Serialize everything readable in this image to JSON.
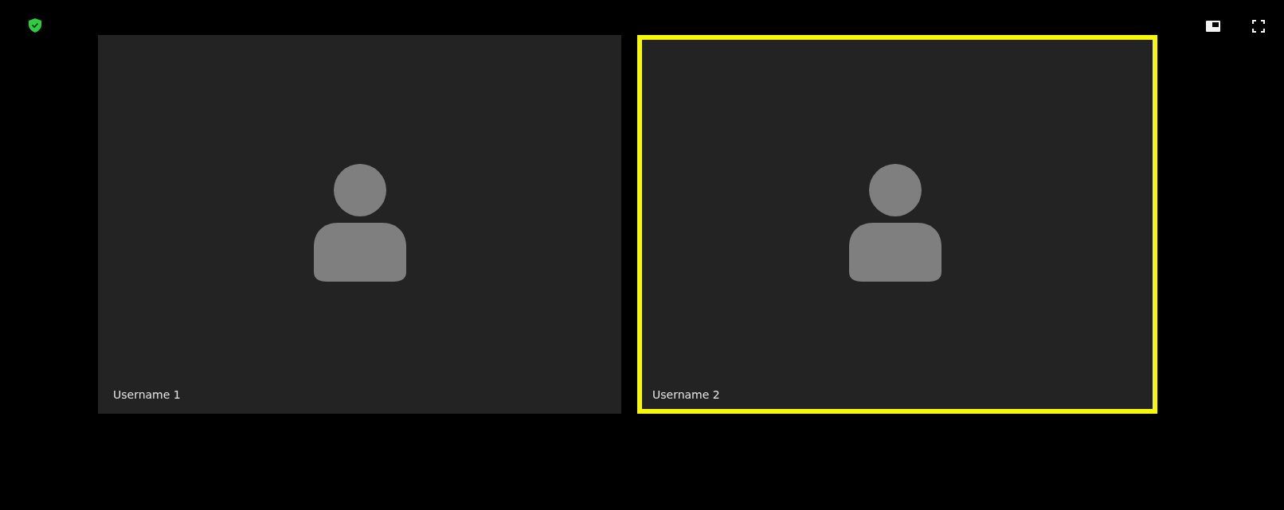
{
  "participants": [
    {
      "name": "Username 1",
      "speaking": false
    },
    {
      "name": "Username 2",
      "speaking": true
    }
  ]
}
